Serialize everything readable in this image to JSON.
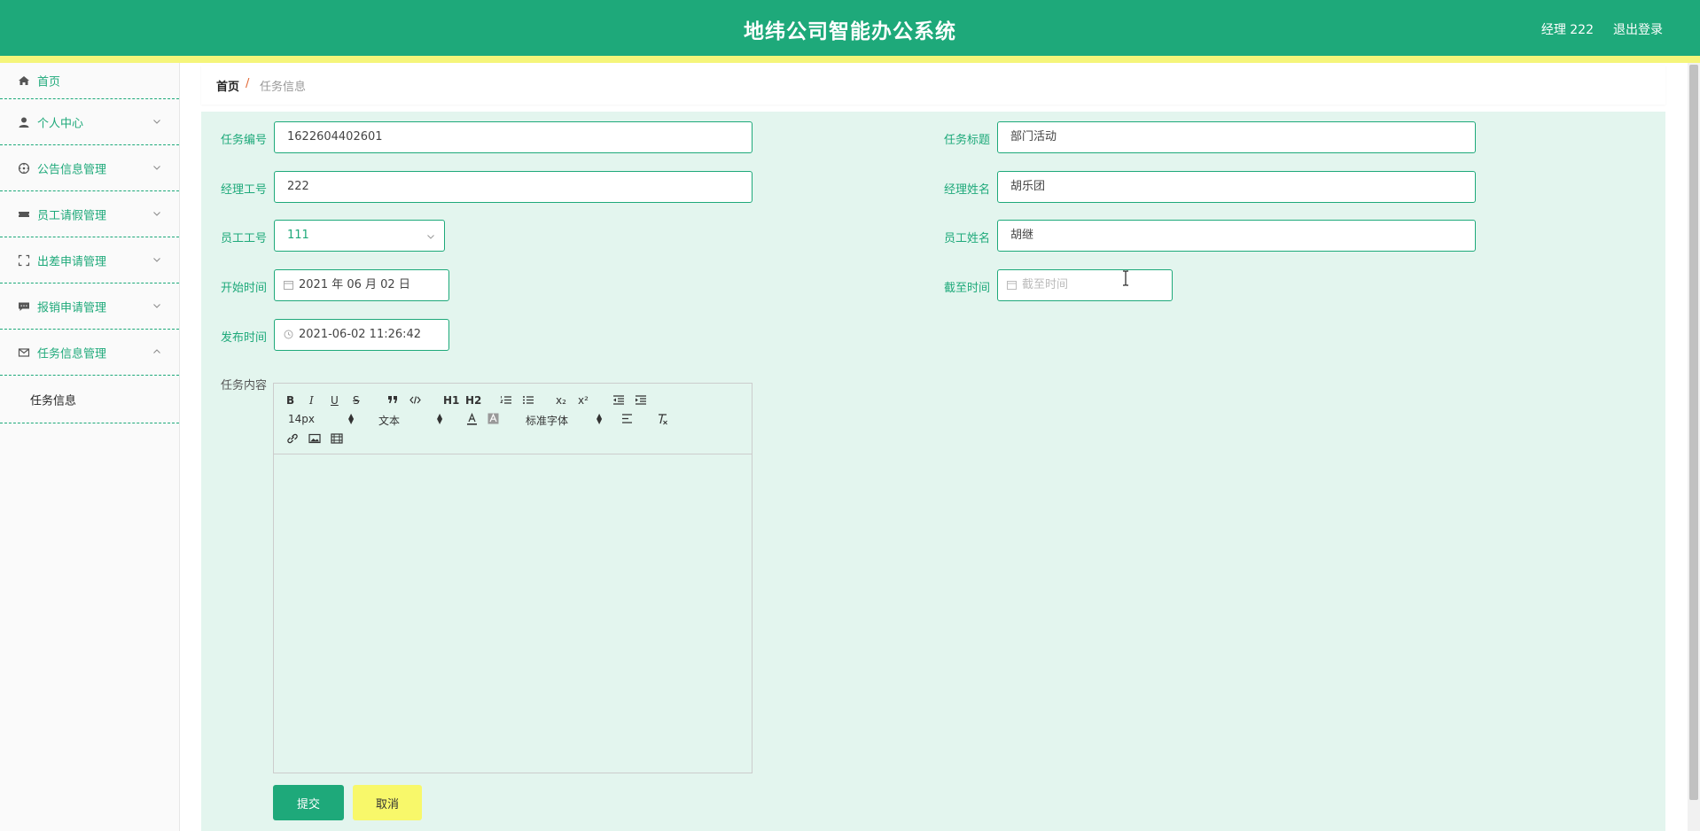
{
  "header": {
    "title": "地纬公司智能办公系统",
    "user": "经理 222",
    "logout": "退出登录"
  },
  "sidebar": {
    "items": [
      {
        "label": "首页",
        "icon": "home-icon"
      },
      {
        "label": "个人中心",
        "icon": "user-icon"
      },
      {
        "label": "公告信息管理",
        "icon": "compass-icon"
      },
      {
        "label": "员工请假管理",
        "icon": "ticket-icon"
      },
      {
        "label": "出差申请管理",
        "icon": "fullscreen-icon"
      },
      {
        "label": "报销申请管理",
        "icon": "comment-icon"
      },
      {
        "label": "任务信息管理",
        "icon": "mail-icon"
      }
    ],
    "submenu": {
      "label": "任务信息"
    }
  },
  "breadcrumb": {
    "home": "首页",
    "separator": "/",
    "current": "任务信息"
  },
  "form": {
    "task_no": {
      "label": "任务编号",
      "value": "1622604402601"
    },
    "task_title": {
      "label": "任务标题",
      "value": "部门活动"
    },
    "manager_no": {
      "label": "经理工号",
      "value": "222"
    },
    "manager_name": {
      "label": "经理姓名",
      "value": "胡乐团"
    },
    "employee_no": {
      "label": "员工工号",
      "value": "111"
    },
    "employee_name": {
      "label": "员工姓名",
      "value": "胡继"
    },
    "start_time": {
      "label": "开始时间",
      "value": "2021 年 06 月 02 日"
    },
    "end_time": {
      "label": "截至时间",
      "placeholder": "截至时间"
    },
    "publish_time": {
      "label": "发布时间",
      "value": "2021-06-02 11:26:42"
    },
    "content": {
      "label": "任务内容"
    }
  },
  "editor": {
    "font_size": "14px",
    "header_select": "文本",
    "font_family": "标准字体",
    "h1": "H1",
    "h2": "H2",
    "bold": "B",
    "italic": "I",
    "underline": "U",
    "strike": "S",
    "subscript": "x₂",
    "superscript": "x²"
  },
  "buttons": {
    "submit": "提交",
    "cancel": "取消"
  },
  "colors": {
    "primary": "#1ea97a",
    "accent_yellow": "#f8f86a",
    "form_bg": "#e3f5ee"
  }
}
